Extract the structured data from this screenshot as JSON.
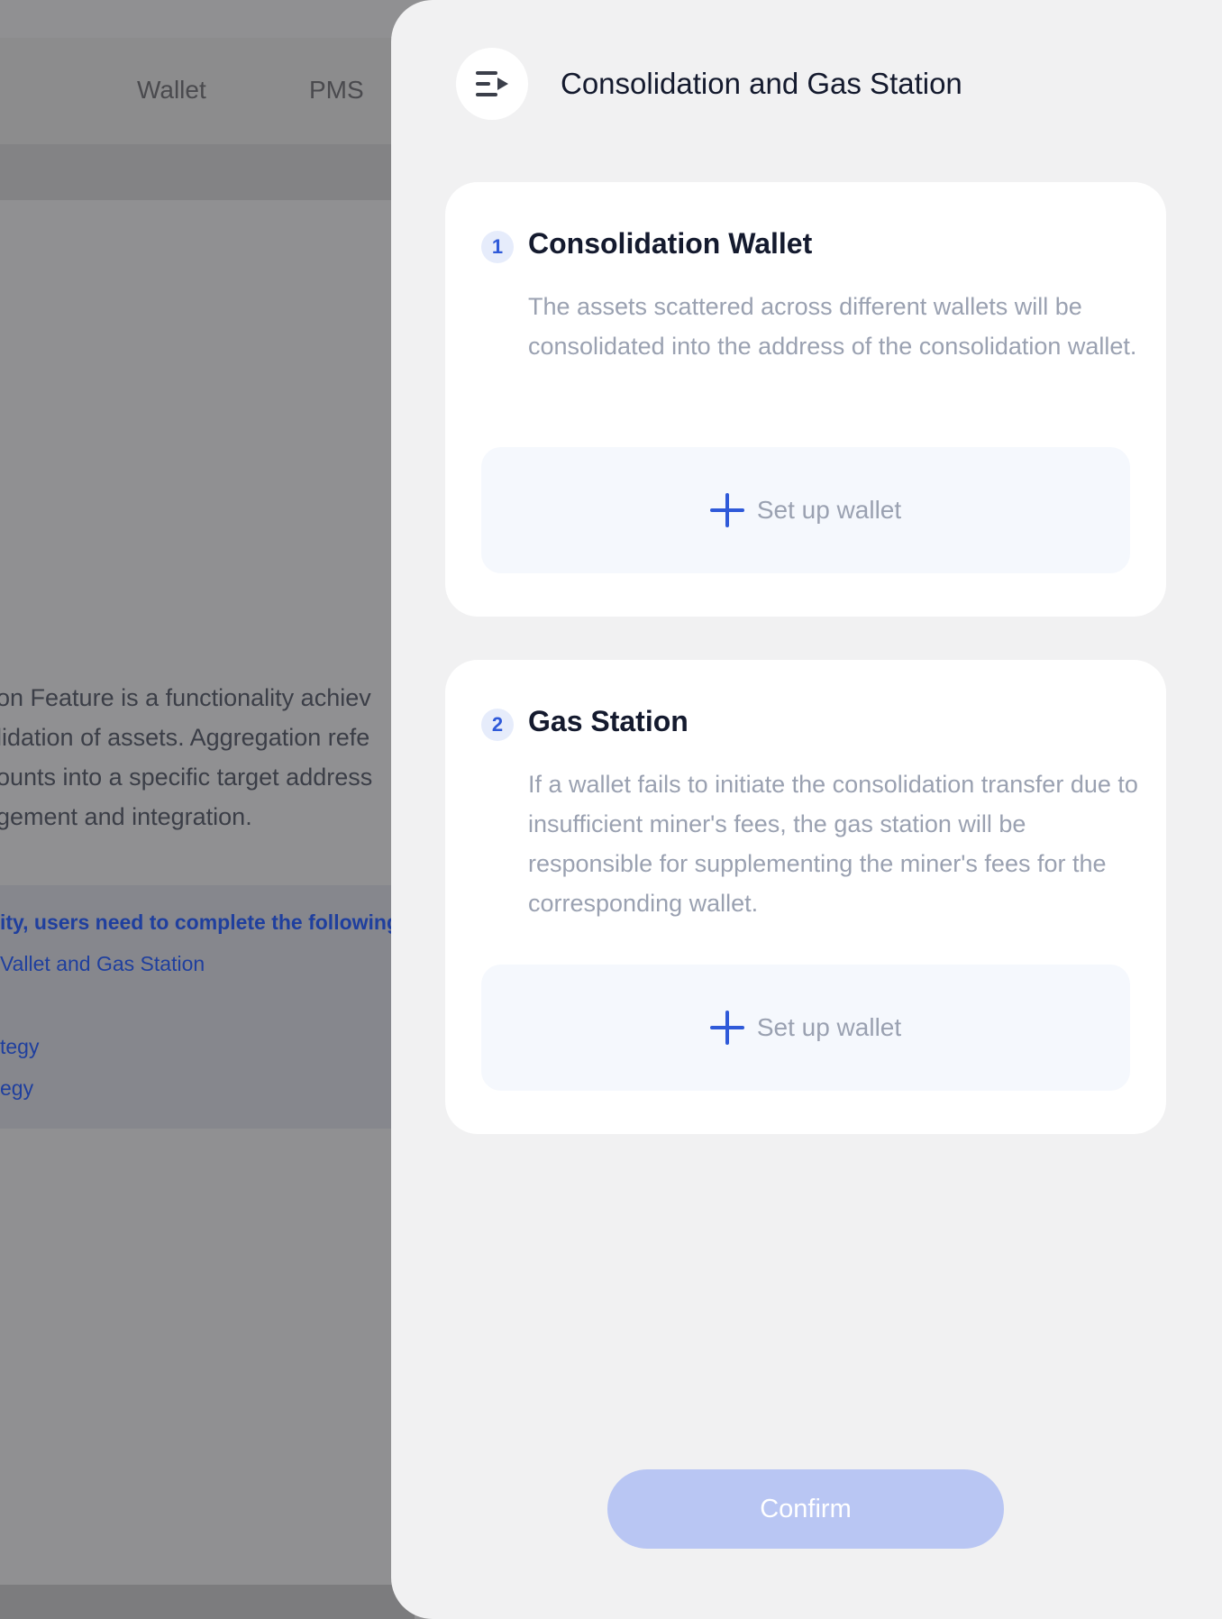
{
  "background": {
    "nav": [
      "Wallet",
      "PMS"
    ],
    "description_lines": [
      "on Feature is a functionality achiev",
      "lidation of assets. Aggregation refe",
      "ounts into a specific target address",
      "gement and integration."
    ],
    "note_lines": [
      "ity, users need to complete the following",
      "Vallet and Gas Station",
      "tegy",
      "egy"
    ]
  },
  "drawer": {
    "title": "Consolidation and Gas Station",
    "collapse_icon": "menu-collapse-icon",
    "cards": [
      {
        "step": "1",
        "title": "Consolidation Wallet",
        "description": "The assets scattered across different wallets will be consolidated into the address of the consolidation wallet.",
        "button_label": "Set up wallet"
      },
      {
        "step": "2",
        "title": "Gas Station",
        "description": "If a wallet fails to initiate the consolidation transfer due to insufficient miner's fees, the gas station will be responsible for supplementing the miner's fees for the corresponding wallet.",
        "button_label": "Set up wallet"
      }
    ],
    "confirm_label": "Confirm"
  },
  "colors": {
    "accent": "#2f5ad9",
    "confirm_disabled": "#b9c6f3",
    "overlay": "#909092",
    "drawer_bg": "#f1f1f2"
  }
}
